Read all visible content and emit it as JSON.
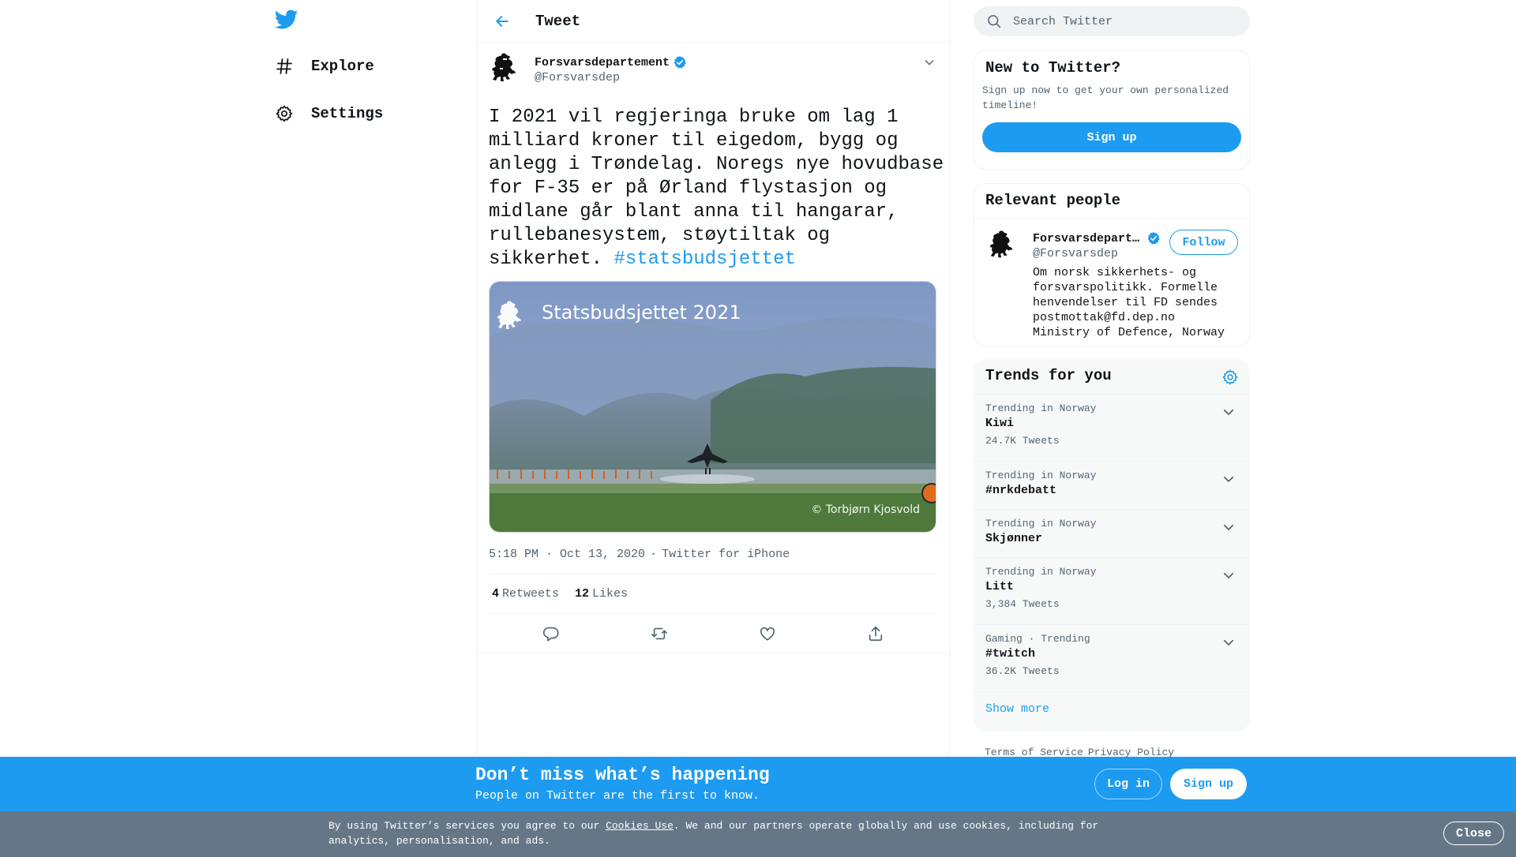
{
  "app": {
    "name": "Twitter",
    "logo_icon": "twitter-bird-icon",
    "accent": "#1d9bf0"
  },
  "nav": {
    "items": [
      {
        "label": "Explore",
        "icon": "hashtag-icon"
      },
      {
        "label": "Settings",
        "icon": "gear-icon"
      }
    ]
  },
  "header": {
    "title": "Tweet",
    "back_icon": "arrow-left-icon"
  },
  "tweet": {
    "author_name": "Forsvarsdepartement",
    "author_handle": "@Forsvarsdep",
    "verified": true,
    "text": "I 2021 vil regjeringa bruke om lag 1 milliard kroner til eigedom, bygg og anlegg i Trøndelag. Noregs nye hovudbase for F-35 er på Ørland flystasjon og midlane går blant anna til hangarar, rullebanesystem, støytiltak og sikkerhet. ",
    "hashtag": "#statsbudsjettet",
    "media": {
      "title": "Statsbudsjettet 2021",
      "credit": "© Torbjørn Kjosvold"
    },
    "time": "5:18 PM · Oct 13, 2020",
    "separator": "·",
    "source": "Twitter for iPhone",
    "retweets": "4",
    "retweets_label": "Retweets",
    "likes": "12",
    "likes_label": "Likes",
    "actions": [
      "reply-icon",
      "retweet-icon",
      "like-icon",
      "share-icon"
    ]
  },
  "search": {
    "placeholder": "Search Twitter"
  },
  "new_to_twitter": {
    "title": "New to Twitter?",
    "subtitle": "Sign up now to get your own personalized timeline!",
    "signup_label": "Sign up"
  },
  "relevant_people": {
    "title": "Relevant people",
    "person": {
      "name": "Forsvarsdepartement",
      "handle": "@Forsvarsdep",
      "bio": "Om norsk sikkerhets- og forsvarspolitikk. Formelle henvendelser til FD sendes postmottak@fd.dep.no Ministry of Defence, Norway",
      "follow_label": "Follow"
    }
  },
  "trends": {
    "title": "Trends for you",
    "items": [
      {
        "context": "Trending in Norway",
        "name": "Kiwi",
        "count": "24.7K Tweets"
      },
      {
        "context": "Trending in Norway",
        "name": "#nrkdebatt",
        "count": ""
      },
      {
        "context": "Trending in Norway",
        "name": "Skjønner",
        "count": ""
      },
      {
        "context": "Trending in Norway",
        "name": "Litt",
        "count": "3,384 Tweets"
      },
      {
        "context": "Gaming · Trending",
        "name": "#twitch",
        "count": "36.2K Tweets"
      }
    ],
    "show_more": "Show more"
  },
  "footer": {
    "terms": "Terms of Service",
    "privacy": "Privacy Policy"
  },
  "bottom_bar": {
    "title": "Don’t miss what’s happening",
    "subtitle": "People on Twitter are the first to know.",
    "login_label": "Log in",
    "signup_label": "Sign up"
  },
  "cookie": {
    "text_before": "By using Twitter’s services you agree to our ",
    "link": "Cookies Use",
    "text_after": ". We and our partners operate globally and use cookies, including for analytics, personalisation, and ads.",
    "close_label": "Close"
  }
}
